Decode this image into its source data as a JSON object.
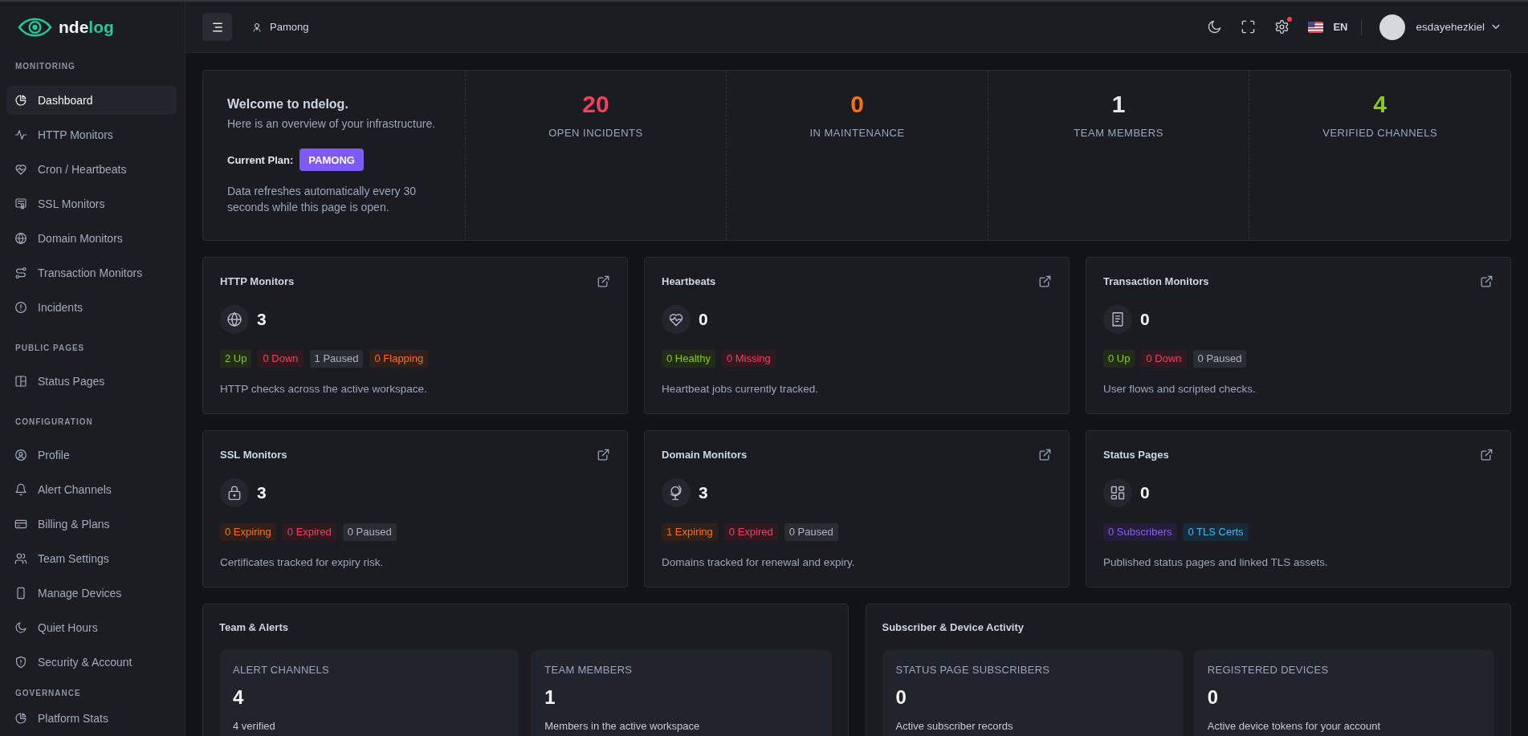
{
  "brand": {
    "prefix": "nde",
    "suffix": "log"
  },
  "sidebar": {
    "sections": [
      {
        "heading": "MONITORING",
        "items": [
          {
            "label": "Dashboard",
            "selected": true
          },
          {
            "label": "HTTP Monitors",
            "selected": false
          },
          {
            "label": "Cron / Heartbeats",
            "selected": false
          },
          {
            "label": "SSL Monitors",
            "selected": false
          },
          {
            "label": "Domain Monitors",
            "selected": false
          },
          {
            "label": "Transaction Monitors",
            "selected": false
          },
          {
            "label": "Incidents",
            "selected": false
          }
        ]
      },
      {
        "heading": "PUBLIC PAGES",
        "items": [
          {
            "label": "Status Pages",
            "selected": false
          }
        ]
      },
      {
        "heading": "CONFIGURATION",
        "items": [
          {
            "label": "Profile",
            "selected": false
          },
          {
            "label": "Alert Channels",
            "selected": false
          },
          {
            "label": "Billing & Plans",
            "selected": false
          },
          {
            "label": "Team Settings",
            "selected": false
          },
          {
            "label": "Manage Devices",
            "selected": false
          },
          {
            "label": "Quiet Hours",
            "selected": false
          },
          {
            "label": "Security & Account",
            "selected": false
          }
        ]
      },
      {
        "heading": "GOVERNANCE",
        "items": [
          {
            "label": "Platform Stats",
            "selected": false
          }
        ]
      }
    ]
  },
  "topbar": {
    "workspace": "Pamong",
    "settings_alert": true,
    "language": "EN",
    "user": "esdayehezkiel"
  },
  "welcome": {
    "title": "Welcome to ndelog.",
    "subtitle": "Here is an overview of your infrastructure.",
    "plan_label": "Current Plan:",
    "plan": "PAMONG",
    "note": "Data refreshes automatically every 30 seconds while this page is open."
  },
  "stats": [
    {
      "value": "20",
      "label": "OPEN INCIDENTS",
      "color": "#f43f5e"
    },
    {
      "value": "0",
      "label": "IN MAINTENANCE",
      "color": "#f97316"
    },
    {
      "value": "1",
      "label": "TEAM MEMBERS",
      "color": "#e5e7eb"
    },
    {
      "value": "4",
      "label": "VERIFIED CHANNELS",
      "color": "#84cc16"
    }
  ],
  "cards": [
    {
      "title": "HTTP Monitors",
      "count": "3",
      "badges": [
        {
          "text": "2 Up",
          "kind": "success"
        },
        {
          "text": "0 Down",
          "kind": "danger"
        },
        {
          "text": "1 Paused",
          "kind": "neutral"
        },
        {
          "text": "0 Flapping",
          "kind": "warning"
        }
      ],
      "description": "HTTP checks across the active workspace."
    },
    {
      "title": "Heartbeats",
      "count": "0",
      "badges": [
        {
          "text": "0 Healthy",
          "kind": "success"
        },
        {
          "text": "0 Missing",
          "kind": "danger"
        }
      ],
      "description": "Heartbeat jobs currently tracked."
    },
    {
      "title": "Transaction Monitors",
      "count": "0",
      "badges": [
        {
          "text": "0 Up",
          "kind": "success"
        },
        {
          "text": "0 Down",
          "kind": "danger"
        },
        {
          "text": "0 Paused",
          "kind": "neutral"
        }
      ],
      "description": "User flows and scripted checks."
    },
    {
      "title": "SSL Monitors",
      "count": "3",
      "badges": [
        {
          "text": "0 Expiring",
          "kind": "warning"
        },
        {
          "text": "0 Expired",
          "kind": "danger"
        },
        {
          "text": "0 Paused",
          "kind": "neutral"
        }
      ],
      "description": "Certificates tracked for expiry risk."
    },
    {
      "title": "Domain Monitors",
      "count": "3",
      "badges": [
        {
          "text": "1 Expiring",
          "kind": "warning"
        },
        {
          "text": "0 Expired",
          "kind": "danger"
        },
        {
          "text": "0 Paused",
          "kind": "neutral"
        }
      ],
      "description": "Domains tracked for renewal and expiry."
    },
    {
      "title": "Status Pages",
      "count": "0",
      "badges": [
        {
          "text": "0 Subscribers",
          "kind": "accent"
        },
        {
          "text": "0 TLS Certs",
          "kind": "info"
        }
      ],
      "description": "Published status pages and linked TLS assets."
    }
  ],
  "panels": [
    {
      "title": "Team & Alerts",
      "tiles": [
        {
          "label": "ALERT CHANNELS",
          "value": "4",
          "note": "4 verified"
        },
        {
          "label": "TEAM MEMBERS",
          "value": "1",
          "note": "Members in the active workspace"
        }
      ]
    },
    {
      "title": "Subscriber & Device Activity",
      "tiles": [
        {
          "label": "STATUS PAGE SUBSCRIBERS",
          "value": "0",
          "note": "Active subscriber records"
        },
        {
          "label": "REGISTERED DEVICES",
          "value": "0",
          "note": "Active device tokens for your account"
        }
      ]
    }
  ]
}
